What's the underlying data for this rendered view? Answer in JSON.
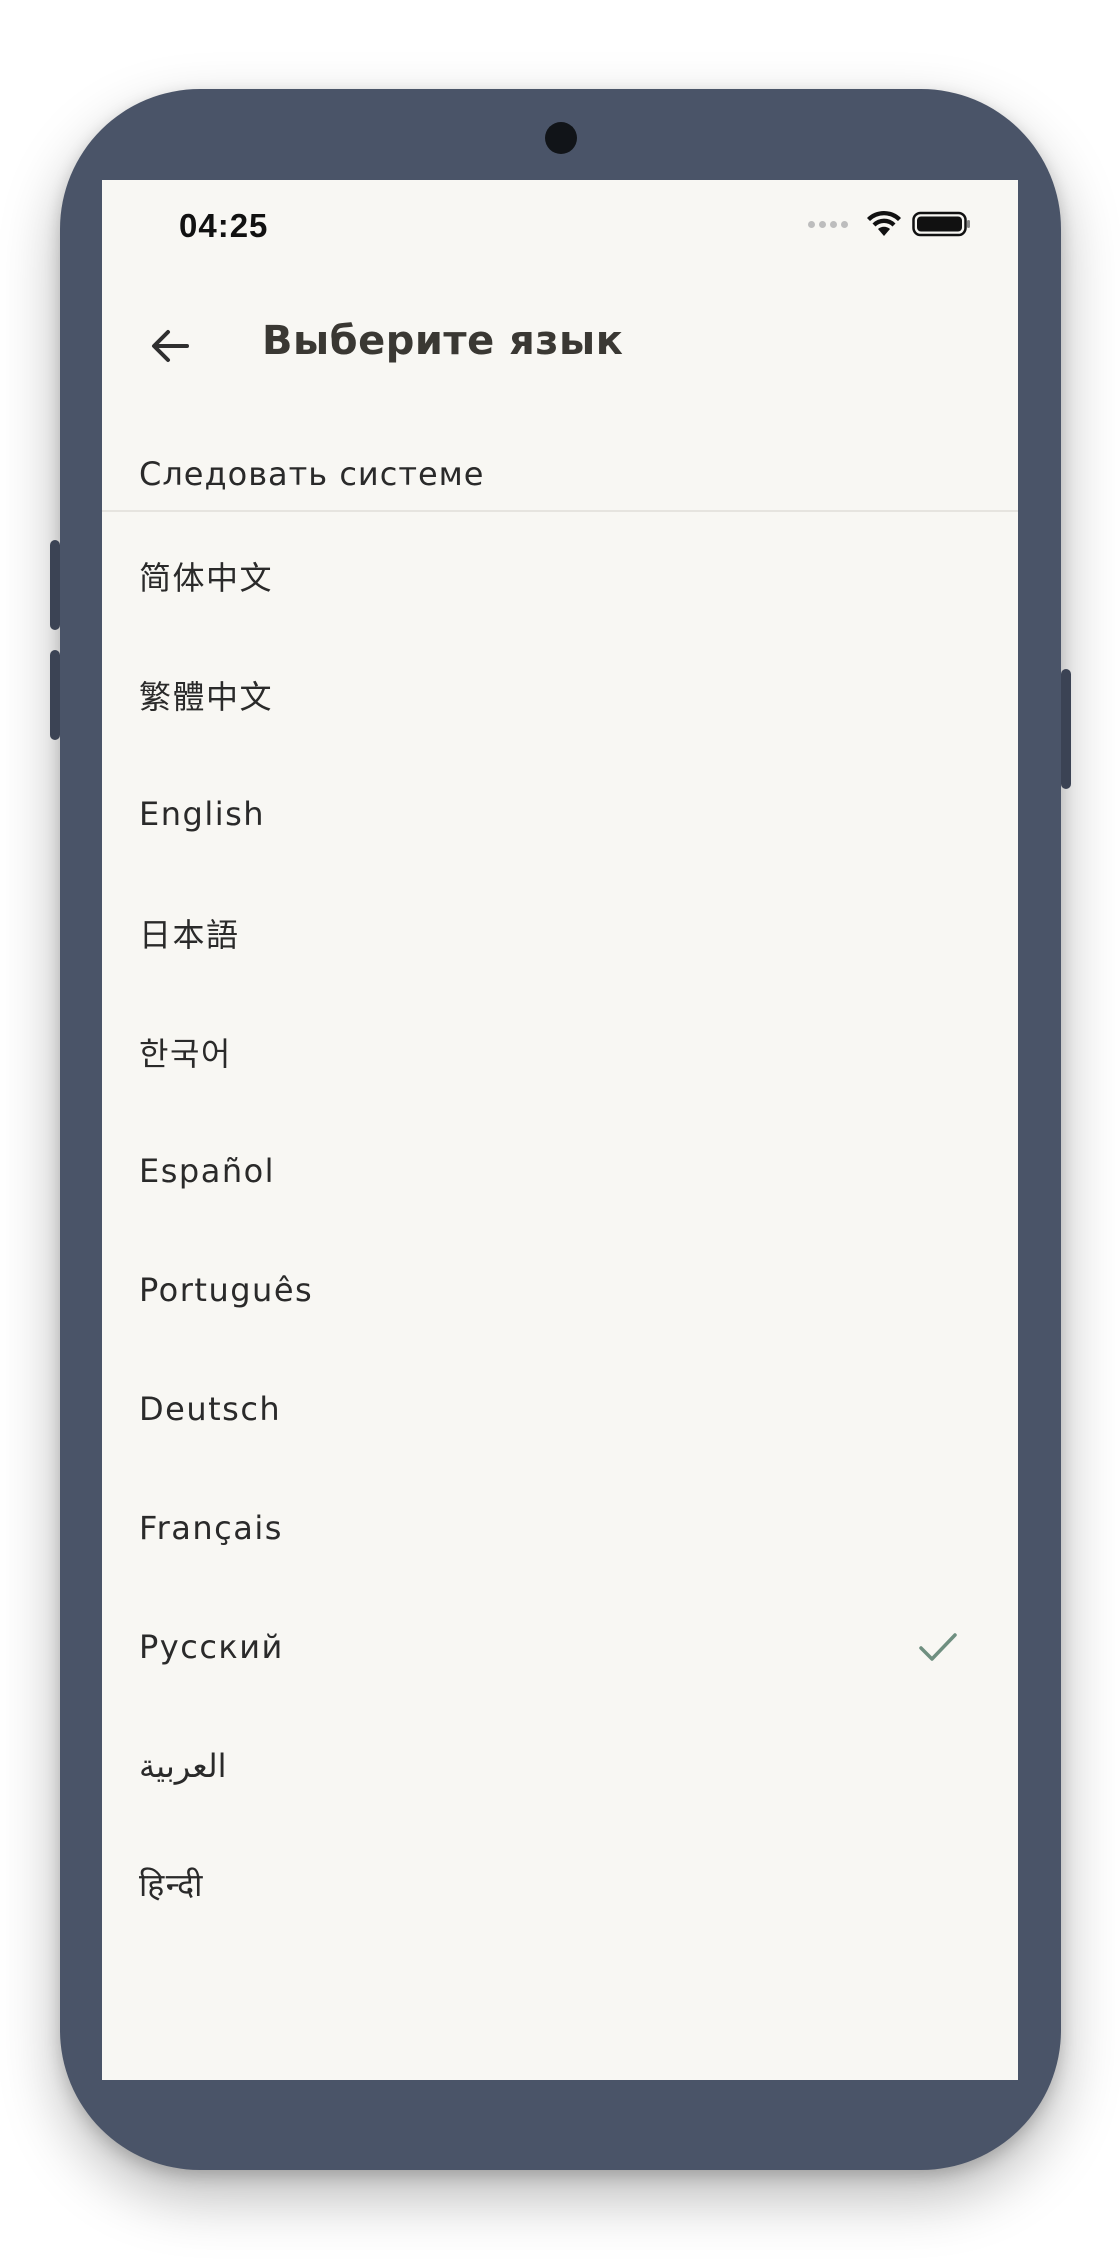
{
  "status_bar": {
    "time": "04:25"
  },
  "app_bar": {
    "title": "Выберите язык",
    "back_icon": "arrow-left-icon"
  },
  "follow_system": {
    "label": "Следовать системе"
  },
  "languages": [
    {
      "label": "简体中文",
      "selected": false
    },
    {
      "label": "繁體中文",
      "selected": false
    },
    {
      "label": "English",
      "selected": false
    },
    {
      "label": "日本語",
      "selected": false
    },
    {
      "label": "한국어",
      "selected": false
    },
    {
      "label": "Español",
      "selected": false
    },
    {
      "label": "Português",
      "selected": false
    },
    {
      "label": "Deutsch",
      "selected": false
    },
    {
      "label": "Français",
      "selected": false
    },
    {
      "label": "Русский",
      "selected": true
    },
    {
      "label": "العربية",
      "selected": false
    },
    {
      "label": "हिन्दी",
      "selected": false
    }
  ],
  "colors": {
    "frame": "#4a5468",
    "screen_bg": "#f8f7f3",
    "check": "#6f8f80",
    "text": "#2a2a2a"
  }
}
